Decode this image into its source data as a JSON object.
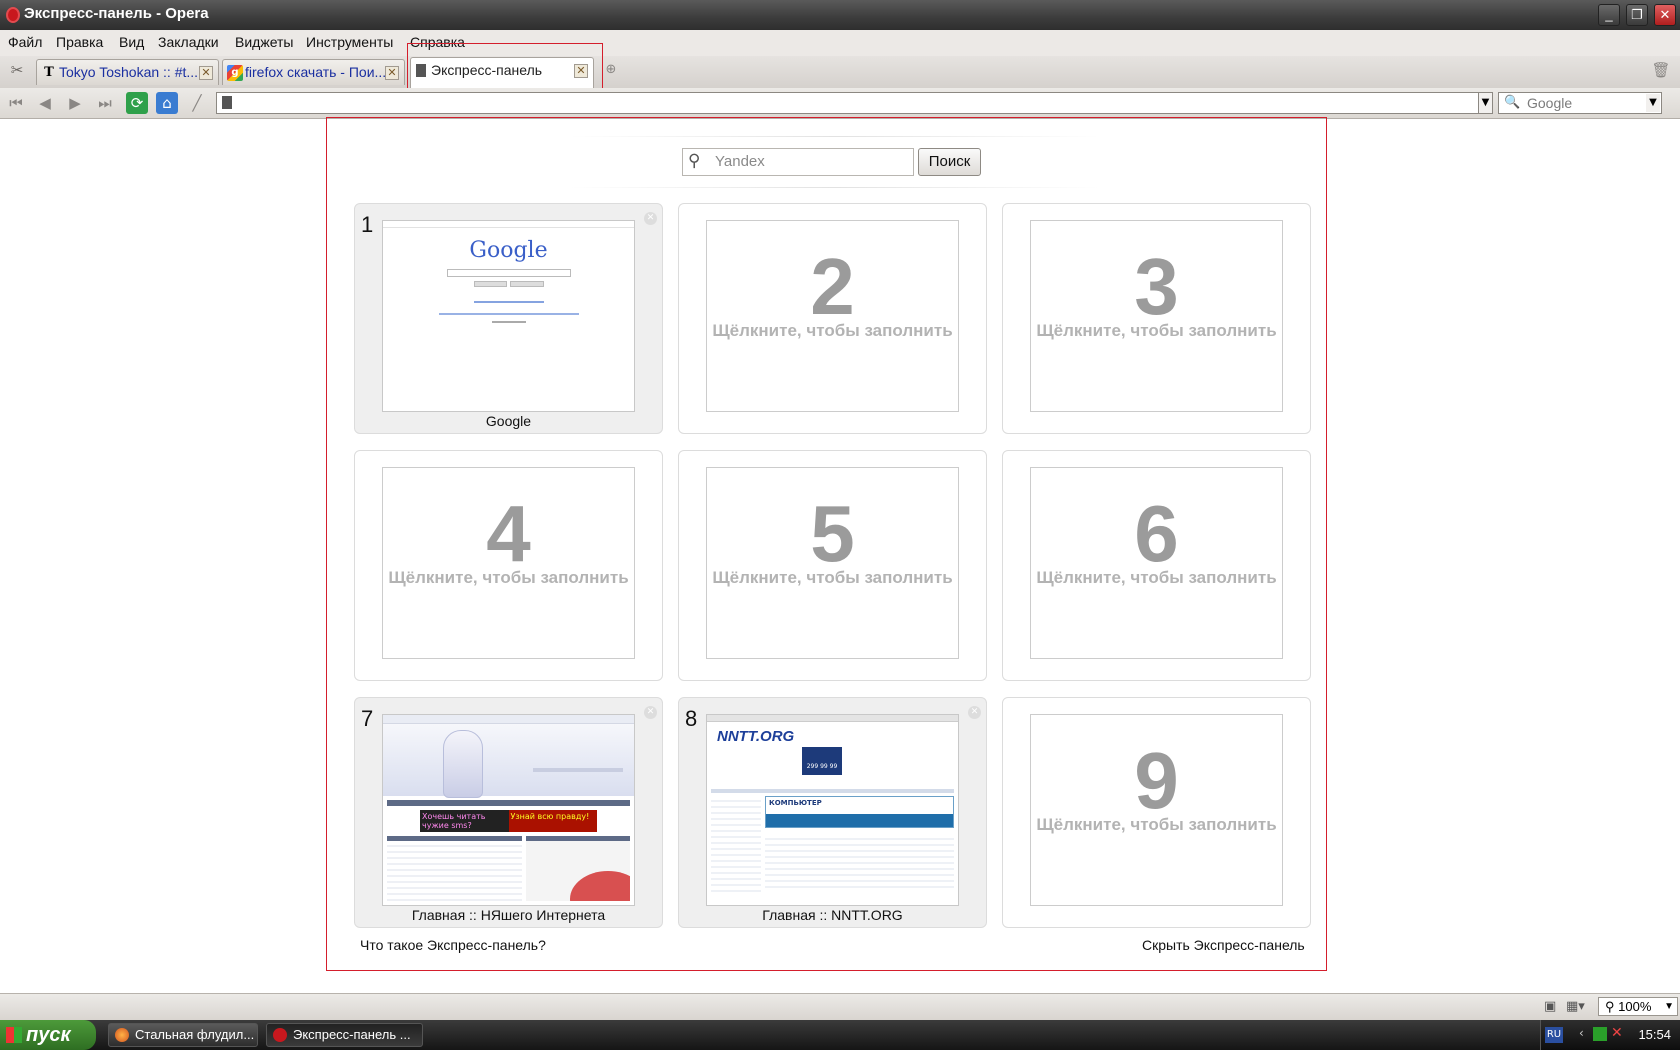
{
  "window": {
    "title": "Экспресс-панель - Opera"
  },
  "menu": [
    "Файл",
    "Правка",
    "Вид",
    "Закладки",
    "Виджеты",
    "Инструменты",
    "Справка"
  ],
  "tabs": [
    {
      "title": "Tokyo Toshokan :: #t...",
      "icon": "T"
    },
    {
      "title": "firefox скачать - Пои...",
      "icon": "g"
    },
    {
      "title": "Экспресс-панель",
      "icon": "doc"
    }
  ],
  "toolbar": {
    "address": "",
    "search_engine": "Google"
  },
  "speed_dial": {
    "search_placeholder": "Yandex",
    "search_button": "Поиск",
    "fill_hint": "Щёлкните, чтобы заполнить",
    "dials": [
      {
        "num": "1",
        "label": "Google",
        "filled": true
      },
      {
        "num": "2",
        "label": "",
        "filled": false
      },
      {
        "num": "3",
        "label": "",
        "filled": false
      },
      {
        "num": "4",
        "label": "",
        "filled": false
      },
      {
        "num": "5",
        "label": "",
        "filled": false
      },
      {
        "num": "6",
        "label": "",
        "filled": false
      },
      {
        "num": "7",
        "label": "Главная :: НЯшего Интернета",
        "filled": true
      },
      {
        "num": "8",
        "label": "Главная :: NNTT.ORG",
        "filled": true
      },
      {
        "num": "9",
        "label": "",
        "filled": false
      }
    ],
    "what_is_link": "Что такое Экспресс-панель?",
    "hide_link": "Скрыть Экспресс-панель"
  },
  "thumb_text": {
    "google_logo": "Google",
    "nntt_logo": "NNTT.ORG",
    "nntt_box": "КОМПЬЮТЕР",
    "nntt_price": "299 99 99",
    "nyash_banner1": "Хочешь читать чужие sms?",
    "nyash_banner2": "Узнай всю правду!"
  },
  "statusbar": {
    "zoom": "100%"
  },
  "taskbar": {
    "start": "пуск",
    "tasks": [
      "Стальная флудил...",
      "Экспресс-панель ..."
    ],
    "lang": "RU",
    "time": "15:54"
  }
}
